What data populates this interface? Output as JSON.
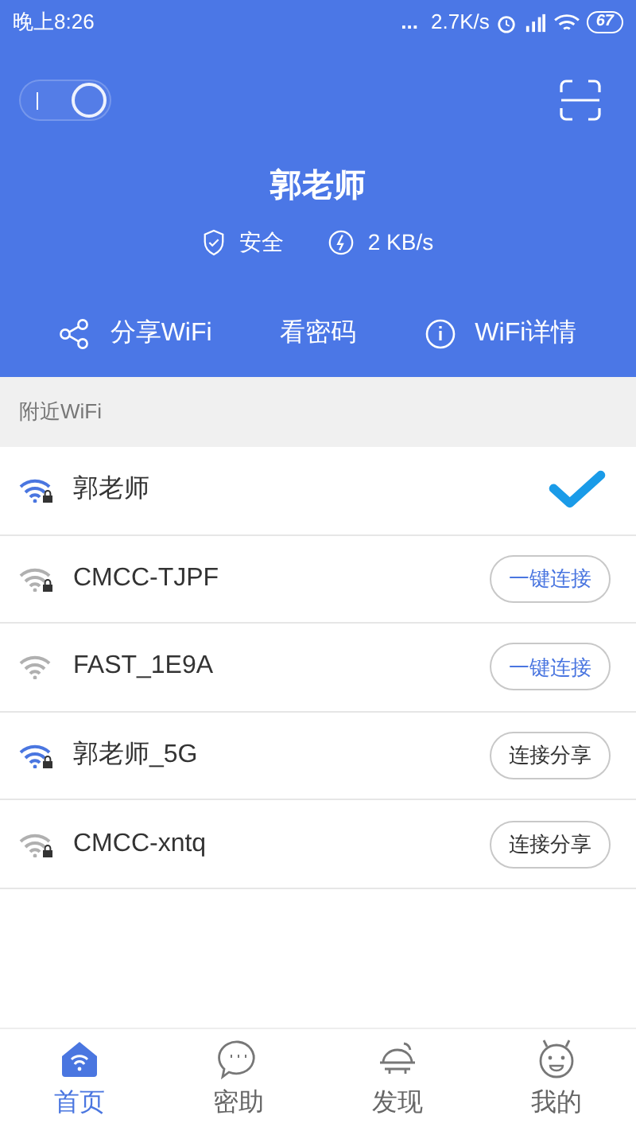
{
  "status_bar": {
    "time": "晚上8:26",
    "dots": "...",
    "speed": "2.7K/s",
    "battery": "67"
  },
  "header": {
    "switch": {
      "on": true
    },
    "name": "郭老师",
    "security": "安全",
    "speed": "2 KB/s",
    "actions": [
      {
        "kind": "share",
        "label": "分享WiFi"
      },
      {
        "kind": "password",
        "label": "看密码"
      },
      {
        "kind": "info",
        "label": "WiFi详情"
      }
    ]
  },
  "section_title": "附近WiFi",
  "networks": [
    {
      "name": "郭老师",
      "color": "#4a76e0",
      "locked": true,
      "connected": true
    },
    {
      "name": "CMCC-TJPF",
      "color": "#b0b0b0",
      "locked": true,
      "connected": false,
      "button": {
        "label": "一键连接",
        "kind": "connect"
      }
    },
    {
      "name": "FAST_1E9A",
      "color": "#b0b0b0",
      "locked": false,
      "connected": false,
      "button": {
        "label": "一键连接",
        "kind": "connect"
      }
    },
    {
      "name": "郭老师_5G",
      "color": "#4a76e0",
      "locked": true,
      "connected": false,
      "button": {
        "label": "连接分享",
        "kind": "share"
      }
    },
    {
      "name": "CMCC-xntq",
      "color": "#b0b0b0",
      "locked": true,
      "connected": false,
      "button": {
        "label": "连接分享",
        "kind": "share"
      }
    }
  ],
  "tabs": [
    {
      "kind": "home",
      "label": "首页",
      "selected": true
    },
    {
      "kind": "chat",
      "label": "密助",
      "selected": false
    },
    {
      "kind": "discover",
      "label": "发现",
      "selected": false
    },
    {
      "kind": "me",
      "label": "我的",
      "selected": false
    }
  ]
}
